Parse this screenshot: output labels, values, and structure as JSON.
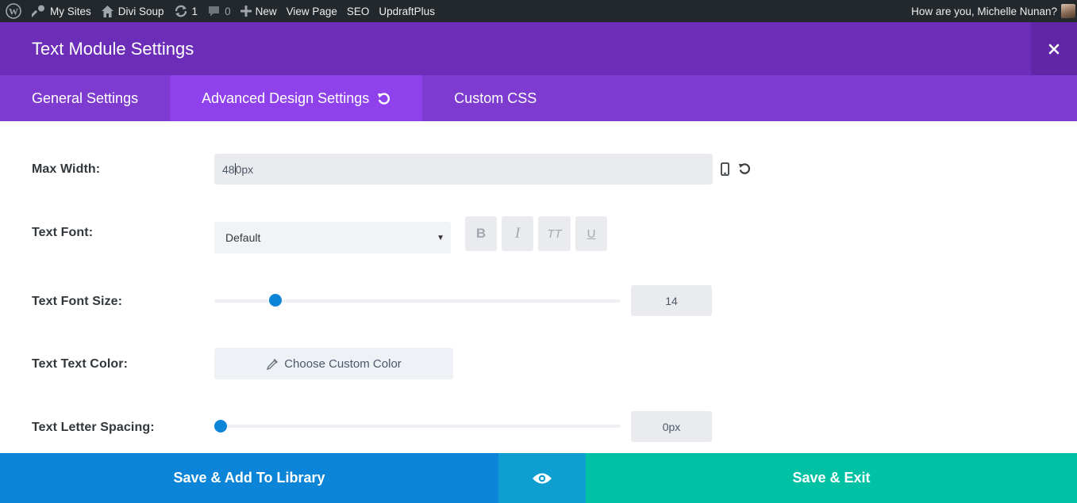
{
  "admin_bar": {
    "my_sites": "My Sites",
    "site_name": "Divi Soup",
    "updates_count": "1",
    "comments_count": "0",
    "new_label": "New",
    "view_page": "View Page",
    "seo": "SEO",
    "updraft": "UpdraftPlus",
    "greeting": "How are you, Michelle Nunan?"
  },
  "modal": {
    "title": "Text Module Settings"
  },
  "tabs": [
    {
      "label": "General Settings",
      "active": false
    },
    {
      "label": "Advanced Design Settings",
      "active": true
    },
    {
      "label": "Custom CSS",
      "active": false
    }
  ],
  "settings": {
    "max_width": {
      "label": "Max Width:",
      "value_before_caret": "48",
      "value_after_caret": "0px"
    },
    "text_font": {
      "label": "Text Font:",
      "selected": "Default",
      "styles": [
        "B",
        "I",
        "TT",
        "U"
      ]
    },
    "text_font_size": {
      "label": "Text Font Size:",
      "value": "14",
      "fraction": 0.14
    },
    "text_color": {
      "label": "Text Text Color:",
      "button_label": "Choose Custom Color"
    },
    "letter_spacing": {
      "label": "Text Letter Spacing:",
      "value": "0px",
      "fraction": 0.0
    }
  },
  "footer": {
    "save_library": "Save & Add To Library",
    "save_exit": "Save & Exit"
  },
  "colors": {
    "header_purple": "#6c2eb9",
    "tab_purple": "#7e3bd0",
    "active_tab": "#8f42ec",
    "blue": "#0c85d9",
    "teal": "#00c1a4"
  }
}
